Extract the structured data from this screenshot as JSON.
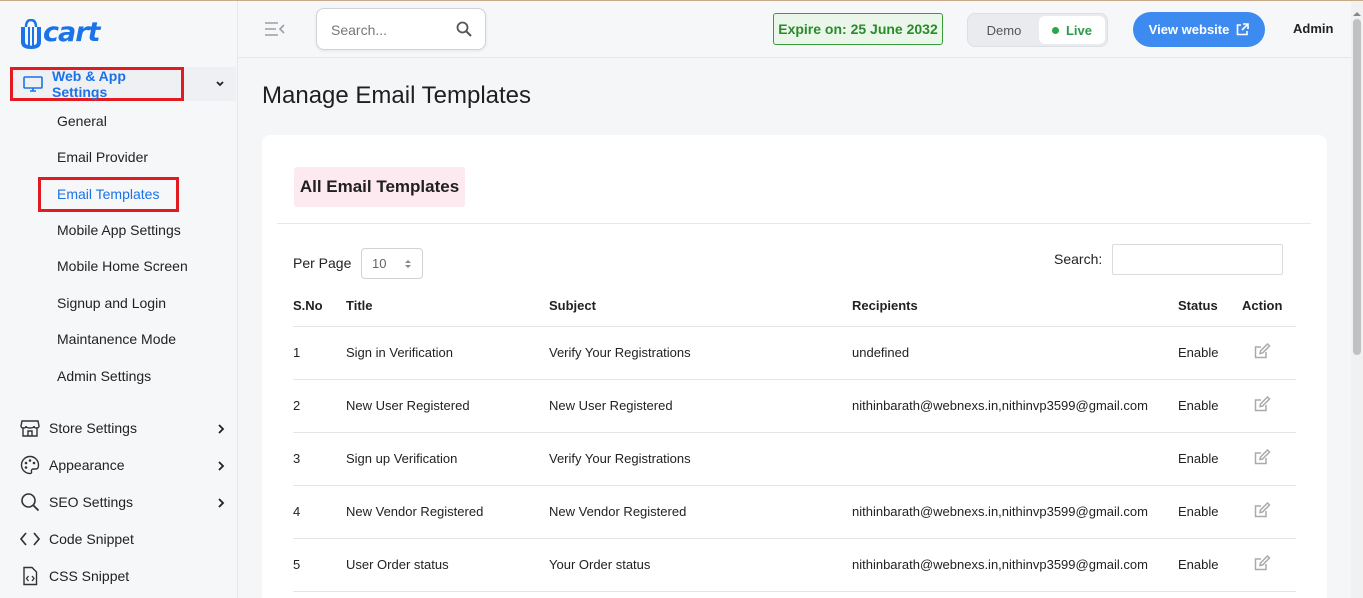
{
  "logo": {
    "text": "cart"
  },
  "sidebar": {
    "parent": {
      "label": "Web & App Settings"
    },
    "sub_items": [
      {
        "label": "General"
      },
      {
        "label": "Email Provider"
      },
      {
        "label": "Email Templates"
      },
      {
        "label": "Mobile App Settings"
      },
      {
        "label": "Mobile Home Screen"
      },
      {
        "label": "Signup and Login"
      },
      {
        "label": "Maintanence Mode"
      },
      {
        "label": "Admin Settings"
      }
    ],
    "items": [
      {
        "label": "Store Settings",
        "icon": "store-icon"
      },
      {
        "label": "Appearance",
        "icon": "palette-icon"
      },
      {
        "label": "SEO Settings",
        "icon": "search-icon"
      },
      {
        "label": "Code Snippet",
        "icon": "code-icon"
      },
      {
        "label": "CSS Snippet",
        "icon": "file-code-icon"
      }
    ]
  },
  "header": {
    "search_placeholder": "Search...",
    "expire": "Expire on: 25 June 2032",
    "mode_demo": "Demo",
    "mode_live": "Live",
    "view_website": "View website",
    "user": "Admin"
  },
  "main": {
    "title": "Manage Email Templates",
    "card_title": "All Email Templates",
    "per_page_label": "Per Page",
    "per_page_value": "10",
    "search_label": "Search:",
    "columns": [
      "S.No",
      "Title",
      "Subject",
      "Recipients",
      "Status",
      "Action"
    ],
    "rows": [
      {
        "sno": "1",
        "title": "Sign in Verification",
        "subject": "Verify Your Registrations",
        "recipients": "undefined",
        "status": "Enable"
      },
      {
        "sno": "2",
        "title": "New User Registered",
        "subject": "New User Registered",
        "recipients": "nithinbarath@webnexs.in,nithinvp3599@gmail.com",
        "status": "Enable"
      },
      {
        "sno": "3",
        "title": "Sign up Verification",
        "subject": "Verify Your Registrations",
        "recipients": "",
        "status": "Enable"
      },
      {
        "sno": "4",
        "title": "New Vendor Registered",
        "subject": "New Vendor Registered",
        "recipients": "nithinbarath@webnexs.in,nithinvp3599@gmail.com",
        "status": "Enable"
      },
      {
        "sno": "5",
        "title": "User Order status",
        "subject": "Your Order status",
        "recipients": "nithinbarath@webnexs.in,nithinvp3599@gmail.com",
        "status": "Enable"
      }
    ]
  },
  "colors": {
    "accent": "#1a73e8",
    "highlight": "#e21b23",
    "live": "#28a745",
    "button": "#3d8bf0"
  }
}
